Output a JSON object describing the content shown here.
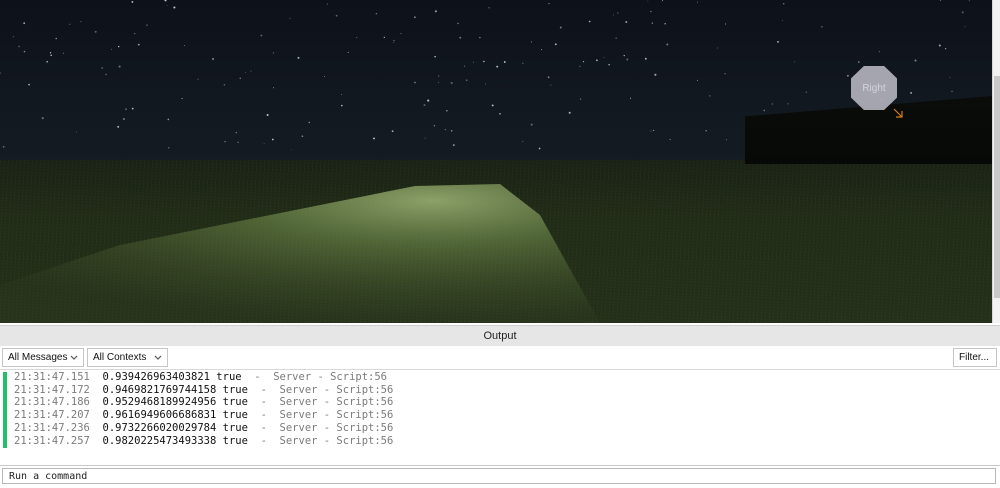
{
  "viewport": {
    "marker_label": "Right"
  },
  "output": {
    "title": "Output",
    "filters": {
      "messages_value": "All Messages",
      "contexts_value": "All Contexts",
      "filter_label": "Filter..."
    },
    "log_lines": [
      {
        "time": "21:31:47.151",
        "message": "0.939426963403821 true",
        "source": "-  Server - Script:56"
      },
      {
        "time": "21:31:47.172",
        "message": "0.9469821769744158 true",
        "source": "-  Server - Script:56"
      },
      {
        "time": "21:31:47.186",
        "message": "0.9529468189924956 true",
        "source": "-  Server - Script:56"
      },
      {
        "time": "21:31:47.207",
        "message": "0.9616949606686831 true",
        "source": "-  Server - Script:56"
      },
      {
        "time": "21:31:47.236",
        "message": "0.9732266020029784 true",
        "source": "-  Server - Script:56"
      },
      {
        "time": "21:31:47.257",
        "message": "0.9820225473493338 true",
        "source": "-  Server - Script:56"
      }
    ],
    "command_placeholder": "Run a command"
  },
  "colors": {
    "log_marker": "#22c06a",
    "panel_header": "#e6e6e6"
  }
}
